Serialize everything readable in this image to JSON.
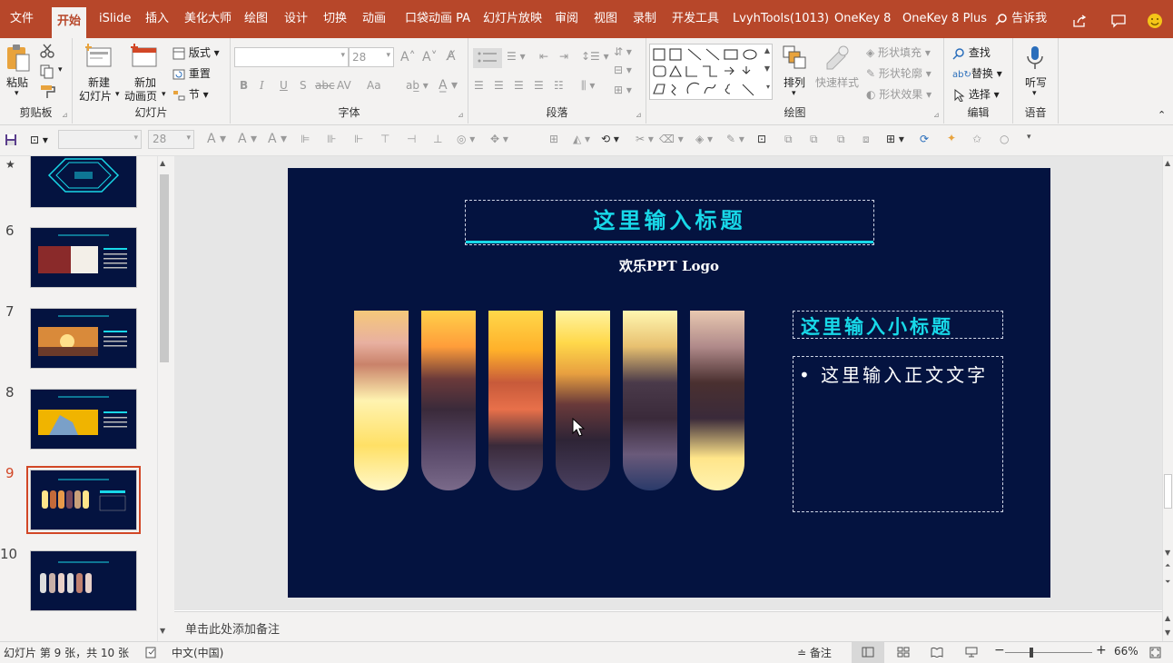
{
  "menubar": {
    "tabs": [
      "文件",
      "开始",
      "iSlide",
      "插入",
      "美化大师",
      "绘图",
      "设计",
      "切换",
      "动画",
      "口袋动画 PA",
      "幻灯片放映",
      "审阅",
      "视图",
      "录制",
      "开发工具",
      "LvyhTools(1013)",
      "OneKey 8",
      "OneKey 8 Plus"
    ],
    "active": "开始",
    "tell_me": "告诉我"
  },
  "ribbon": {
    "clipboard": {
      "label": "剪贴板",
      "paste": "粘贴"
    },
    "slides": {
      "label": "幻灯片",
      "new_slide": "新建",
      "new_slide2": "幻灯片",
      "new_page": "新加",
      "new_page2": "动画页",
      "layout": "版式",
      "reset": "重置",
      "section": "节"
    },
    "font": {
      "label": "字体",
      "font_name": "",
      "font_size": "28",
      "buttons": [
        "B",
        "I",
        "U",
        "S",
        "abc",
        "AV",
        "Aa"
      ]
    },
    "paragraph": {
      "label": "段落"
    },
    "drawing": {
      "label": "绘图",
      "arrange": "排列",
      "quick_styles": "快速样式",
      "shape_fill": "形状填充",
      "shape_outline": "形状轮廓",
      "shape_effects": "形状效果"
    },
    "editing": {
      "label": "编辑",
      "find": "查找",
      "replace": "替换",
      "select": "选择"
    },
    "voice": {
      "label": "语音",
      "dictate": "听写"
    }
  },
  "qat": {
    "font_size": "28"
  },
  "thumbnails": [
    {
      "num": "★",
      "selected": false
    },
    {
      "num": "6",
      "selected": false
    },
    {
      "num": "7",
      "selected": false
    },
    {
      "num": "8",
      "selected": false
    },
    {
      "num": "9",
      "selected": true
    },
    {
      "num": "10",
      "selected": false
    }
  ],
  "slide": {
    "title": "这里输入标题",
    "logo_text": "欢乐PPT Logo",
    "subtitle": "这里输入小标题",
    "body_bullet": "这里输入正文文字"
  },
  "notes": {
    "placeholder": "单击此处添加备注"
  },
  "status": {
    "slide_info": "幻灯片 第 9 张，共 10 张",
    "language": "中文(中国)",
    "notes_btn": "备注",
    "zoom": "66%"
  },
  "colors": {
    "titlebar": "#b7472a",
    "slide_bg": "#041340",
    "accent": "#18d8e8",
    "selection": "#d24726"
  }
}
